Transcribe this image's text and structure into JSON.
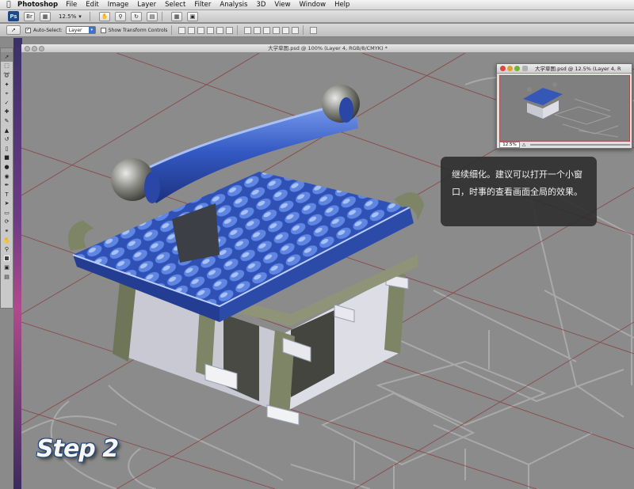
{
  "menubar": {
    "app_name": "Photoshop",
    "items": [
      "File",
      "Edit",
      "Image",
      "Layer",
      "Select",
      "Filter",
      "Analysis",
      "3D",
      "View",
      "Window",
      "Help"
    ]
  },
  "appbar": {
    "logo": "Ps",
    "zoom": "12.5%"
  },
  "options": {
    "auto_select_label": "Auto-Select:",
    "auto_select_value": "Layer",
    "show_transform_label": "Show Transform Controls"
  },
  "document": {
    "title": "大学草图.psd @ 100% (Layer 4, RGB/8/CMYK) *"
  },
  "navigator": {
    "title": "大学草图.psd @ 12.5% (Layer 4, R",
    "zoom": "12.5%"
  },
  "tip": {
    "text": "继续细化。建议可以打开一个小窗口，时事的查看画面全局的效果。"
  },
  "step_label": "Step 2",
  "colors": {
    "roof_blue": "#3457b8",
    "wall_olive": "#7e8567",
    "tip_bg": "#2d2d2d",
    "grid_red": "#8a2f2f"
  }
}
